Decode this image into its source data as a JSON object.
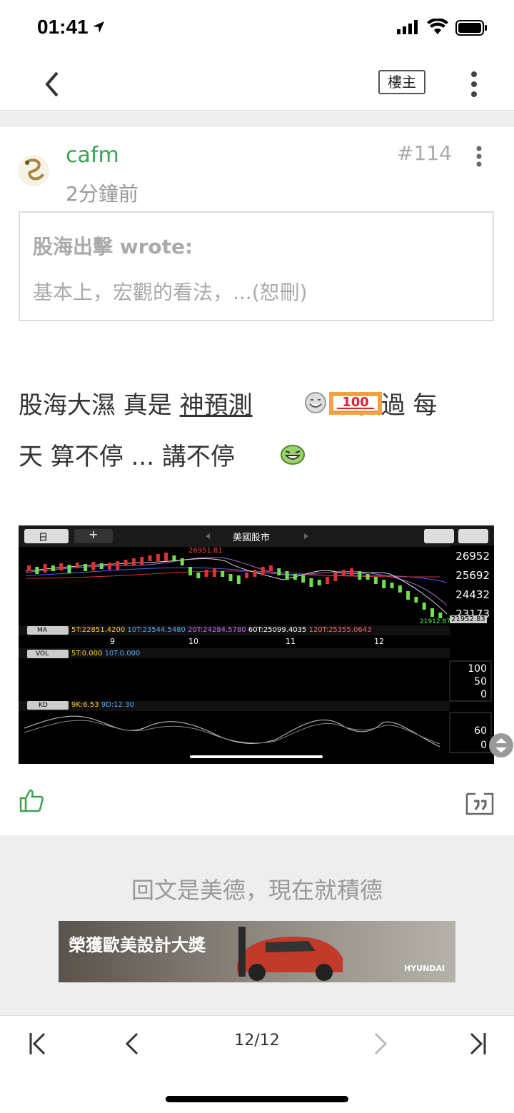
{
  "status": {
    "time": "01:41"
  },
  "nav": {
    "owner_label": "樓主"
  },
  "post": {
    "username": "cafm",
    "time_ago": "2分鐘前",
    "number": "#114",
    "quote_author": "股海出擊 wrote:",
    "quote_text": "基本上，宏觀的看法，...(恕刪)",
    "text_part1": "股海大濕 真是 ",
    "text_link": "神預測",
    "text_part2": "強過 每",
    "text_line2": "天 算不停 ... 講不停",
    "badge_100": "100"
  },
  "chart_image": {
    "title": "美國股市",
    "period_button": "日",
    "add_button": "+",
    "price_axis": [
      "26952",
      "25692",
      "24432",
      "23173"
    ],
    "last_price": "21952.83",
    "low_label": "21912.87",
    "high_label": "26951.81",
    "x_labels": [
      "9",
      "10",
      "11",
      "12"
    ],
    "ma_label": "MA",
    "ma_values": [
      "5T:22851.4200",
      "10T:23544.5480",
      "20T:24284.5780",
      "60T:25099.4035",
      "120T:25355.0643"
    ],
    "vol_label": "VOL",
    "vol_values": [
      "5T:0.000",
      "10T:0.000"
    ],
    "vol_axis": [
      "100",
      "50",
      "0"
    ],
    "kd_label": "KD",
    "kd_values": [
      "9K:6.53",
      "9D:12.30"
    ],
    "kd_axis": [
      "60",
      "0"
    ]
  },
  "ad": {
    "text": "回文是美德，現在就積德",
    "banner_text": "榮獲歐美設計大獎",
    "banner_brand": "HYUNDAI"
  },
  "pager": {
    "current": "12/12"
  },
  "colors": {
    "green": "#3aa250",
    "gray_text": "#999999",
    "chart_bg": "#000000"
  }
}
